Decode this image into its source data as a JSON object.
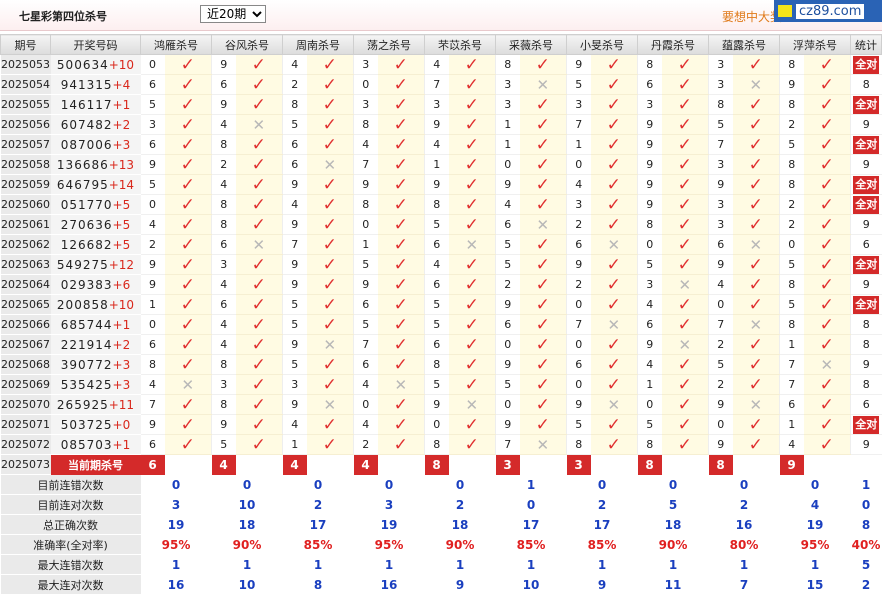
{
  "header": {
    "title": "七星彩第四位杀号",
    "period_selected": "近20期",
    "period_options": [
      "近20期"
    ],
    "promo": "要想中大奖",
    "watermark": "cz89.com"
  },
  "columns": {
    "issue": "期号",
    "number": "开奖号码",
    "experts": [
      "鸿雁杀号",
      "谷风杀号",
      "周南杀号",
      "荡之杀号",
      "芣苡杀号",
      "采薇杀号",
      "小旻杀号",
      "丹霞杀号",
      "蕴露杀号",
      "浮萍杀号"
    ],
    "stat": "统计"
  },
  "all_right_label": "全对",
  "rows": [
    {
      "issue": "2025053",
      "digits": "500634",
      "sum": "+10",
      "kills": [
        [
          "0",
          1
        ],
        [
          "9",
          1
        ],
        [
          "4",
          1
        ],
        [
          "3",
          1
        ],
        [
          "4",
          1
        ],
        [
          "8",
          1
        ],
        [
          "9",
          1
        ],
        [
          "8",
          1
        ],
        [
          "3",
          1
        ],
        [
          "8",
          1
        ]
      ],
      "stat": "全对"
    },
    {
      "issue": "2025054",
      "digits": "941315",
      "sum": "+4",
      "kills": [
        [
          "6",
          1
        ],
        [
          "6",
          1
        ],
        [
          "2",
          1
        ],
        [
          "0",
          1
        ],
        [
          "7",
          1
        ],
        [
          "3",
          0
        ],
        [
          "5",
          1
        ],
        [
          "6",
          1
        ],
        [
          "3",
          0
        ],
        [
          "9",
          1
        ]
      ],
      "stat": "8"
    },
    {
      "issue": "2025055",
      "digits": "146117",
      "sum": "+1",
      "kills": [
        [
          "5",
          1
        ],
        [
          "9",
          1
        ],
        [
          "8",
          1
        ],
        [
          "3",
          1
        ],
        [
          "3",
          1
        ],
        [
          "3",
          1
        ],
        [
          "3",
          1
        ],
        [
          "3",
          1
        ],
        [
          "8",
          1
        ],
        [
          "8",
          1
        ]
      ],
      "stat": "全对"
    },
    {
      "issue": "2025056",
      "digits": "607482",
      "sum": "+2",
      "kills": [
        [
          "3",
          1
        ],
        [
          "4",
          0
        ],
        [
          "5",
          1
        ],
        [
          "8",
          1
        ],
        [
          "9",
          1
        ],
        [
          "1",
          1
        ],
        [
          "7",
          1
        ],
        [
          "9",
          1
        ],
        [
          "5",
          1
        ],
        [
          "2",
          1
        ]
      ],
      "stat": "9"
    },
    {
      "issue": "2025057",
      "digits": "087006",
      "sum": "+3",
      "kills": [
        [
          "6",
          1
        ],
        [
          "8",
          1
        ],
        [
          "6",
          1
        ],
        [
          "4",
          1
        ],
        [
          "4",
          1
        ],
        [
          "1",
          1
        ],
        [
          "1",
          1
        ],
        [
          "9",
          1
        ],
        [
          "7",
          1
        ],
        [
          "5",
          1
        ]
      ],
      "stat": "全对"
    },
    {
      "issue": "2025058",
      "digits": "136686",
      "sum": "+13",
      "kills": [
        [
          "9",
          1
        ],
        [
          "2",
          1
        ],
        [
          "6",
          0
        ],
        [
          "7",
          1
        ],
        [
          "1",
          1
        ],
        [
          "0",
          1
        ],
        [
          "0",
          1
        ],
        [
          "9",
          1
        ],
        [
          "3",
          1
        ],
        [
          "8",
          1
        ]
      ],
      "stat": "9"
    },
    {
      "issue": "2025059",
      "digits": "646795",
      "sum": "+14",
      "kills": [
        [
          "5",
          1
        ],
        [
          "4",
          1
        ],
        [
          "9",
          1
        ],
        [
          "9",
          1
        ],
        [
          "9",
          1
        ],
        [
          "9",
          1
        ],
        [
          "4",
          1
        ],
        [
          "9",
          1
        ],
        [
          "9",
          1
        ],
        [
          "8",
          1
        ]
      ],
      "stat": "全对"
    },
    {
      "issue": "2025060",
      "digits": "051770",
      "sum": "+5",
      "kills": [
        [
          "0",
          1
        ],
        [
          "8",
          1
        ],
        [
          "4",
          1
        ],
        [
          "8",
          1
        ],
        [
          "8",
          1
        ],
        [
          "4",
          1
        ],
        [
          "3",
          1
        ],
        [
          "9",
          1
        ],
        [
          "3",
          1
        ],
        [
          "2",
          1
        ]
      ],
      "stat": "全对"
    },
    {
      "issue": "2025061",
      "digits": "270636",
      "sum": "+5",
      "kills": [
        [
          "4",
          1
        ],
        [
          "8",
          1
        ],
        [
          "9",
          1
        ],
        [
          "0",
          1
        ],
        [
          "5",
          1
        ],
        [
          "6",
          0
        ],
        [
          "2",
          1
        ],
        [
          "8",
          1
        ],
        [
          "3",
          1
        ],
        [
          "2",
          1
        ]
      ],
      "stat": "9"
    },
    {
      "issue": "2025062",
      "digits": "126682",
      "sum": "+5",
      "kills": [
        [
          "2",
          1
        ],
        [
          "6",
          0
        ],
        [
          "7",
          1
        ],
        [
          "1",
          1
        ],
        [
          "6",
          0
        ],
        [
          "5",
          1
        ],
        [
          "6",
          0
        ],
        [
          "0",
          1
        ],
        [
          "6",
          0
        ],
        [
          "0",
          1
        ]
      ],
      "stat": "6"
    },
    {
      "issue": "2025063",
      "digits": "549275",
      "sum": "+12",
      "kills": [
        [
          "9",
          1
        ],
        [
          "3",
          1
        ],
        [
          "9",
          1
        ],
        [
          "5",
          1
        ],
        [
          "4",
          1
        ],
        [
          "5",
          1
        ],
        [
          "9",
          1
        ],
        [
          "5",
          1
        ],
        [
          "9",
          1
        ],
        [
          "5",
          1
        ]
      ],
      "stat": "全对"
    },
    {
      "issue": "2025064",
      "digits": "029383",
      "sum": "+6",
      "kills": [
        [
          "9",
          1
        ],
        [
          "4",
          1
        ],
        [
          "9",
          1
        ],
        [
          "9",
          1
        ],
        [
          "6",
          1
        ],
        [
          "2",
          1
        ],
        [
          "2",
          1
        ],
        [
          "3",
          0
        ],
        [
          "4",
          1
        ],
        [
          "8",
          1
        ]
      ],
      "stat": "9"
    },
    {
      "issue": "2025065",
      "digits": "200858",
      "sum": "+10",
      "kills": [
        [
          "1",
          1
        ],
        [
          "6",
          1
        ],
        [
          "5",
          1
        ],
        [
          "6",
          1
        ],
        [
          "5",
          1
        ],
        [
          "9",
          1
        ],
        [
          "0",
          1
        ],
        [
          "4",
          1
        ],
        [
          "0",
          1
        ],
        [
          "5",
          1
        ]
      ],
      "stat": "全对"
    },
    {
      "issue": "2025066",
      "digits": "685744",
      "sum": "+1",
      "kills": [
        [
          "0",
          1
        ],
        [
          "4",
          1
        ],
        [
          "5",
          1
        ],
        [
          "5",
          1
        ],
        [
          "5",
          1
        ],
        [
          "6",
          1
        ],
        [
          "7",
          0
        ],
        [
          "6",
          1
        ],
        [
          "7",
          0
        ],
        [
          "8",
          1
        ]
      ],
      "stat": "8"
    },
    {
      "issue": "2025067",
      "digits": "221914",
      "sum": "+2",
      "kills": [
        [
          "6",
          1
        ],
        [
          "4",
          1
        ],
        [
          "9",
          0
        ],
        [
          "7",
          1
        ],
        [
          "6",
          1
        ],
        [
          "0",
          1
        ],
        [
          "0",
          1
        ],
        [
          "9",
          0
        ],
        [
          "2",
          1
        ],
        [
          "1",
          1
        ]
      ],
      "stat": "8"
    },
    {
      "issue": "2025068",
      "digits": "390772",
      "sum": "+3",
      "kills": [
        [
          "8",
          1
        ],
        [
          "8",
          1
        ],
        [
          "5",
          1
        ],
        [
          "6",
          1
        ],
        [
          "8",
          1
        ],
        [
          "9",
          1
        ],
        [
          "6",
          1
        ],
        [
          "4",
          1
        ],
        [
          "5",
          1
        ],
        [
          "7",
          0
        ]
      ],
      "stat": "9"
    },
    {
      "issue": "2025069",
      "digits": "535425",
      "sum": "+3",
      "kills": [
        [
          "4",
          0
        ],
        [
          "3",
          1
        ],
        [
          "3",
          1
        ],
        [
          "4",
          0
        ],
        [
          "5",
          1
        ],
        [
          "5",
          1
        ],
        [
          "0",
          1
        ],
        [
          "1",
          1
        ],
        [
          "2",
          1
        ],
        [
          "7",
          1
        ]
      ],
      "stat": "8"
    },
    {
      "issue": "2025070",
      "digits": "265925",
      "sum": "+11",
      "kills": [
        [
          "7",
          1
        ],
        [
          "8",
          1
        ],
        [
          "9",
          0
        ],
        [
          "0",
          1
        ],
        [
          "9",
          0
        ],
        [
          "0",
          1
        ],
        [
          "9",
          0
        ],
        [
          "0",
          1
        ],
        [
          "9",
          0
        ],
        [
          "6",
          1
        ]
      ],
      "stat": "6"
    },
    {
      "issue": "2025071",
      "digits": "503725",
      "sum": "+0",
      "kills": [
        [
          "9",
          1
        ],
        [
          "9",
          1
        ],
        [
          "4",
          1
        ],
        [
          "4",
          1
        ],
        [
          "0",
          1
        ],
        [
          "9",
          1
        ],
        [
          "5",
          1
        ],
        [
          "5",
          1
        ],
        [
          "0",
          1
        ],
        [
          "1",
          1
        ]
      ],
      "stat": "全对"
    },
    {
      "issue": "2025072",
      "digits": "085703",
      "sum": "+1",
      "kills": [
        [
          "6",
          1
        ],
        [
          "5",
          1
        ],
        [
          "1",
          1
        ],
        [
          "2",
          1
        ],
        [
          "8",
          1
        ],
        [
          "7",
          0
        ],
        [
          "8",
          1
        ],
        [
          "8",
          1
        ],
        [
          "9",
          1
        ],
        [
          "4",
          1
        ]
      ],
      "stat": "9"
    }
  ],
  "current": {
    "issue": "2025073",
    "label": "当前期杀号",
    "kills": [
      "6",
      "4",
      "4",
      "4",
      "8",
      "3",
      "3",
      "8",
      "8",
      "9"
    ]
  },
  "summary": [
    {
      "label": "目前连错次数",
      "values": [
        "0",
        "0",
        "0",
        "0",
        "0",
        "1",
        "0",
        "0",
        "0",
        "0"
      ],
      "stat": "1"
    },
    {
      "label": "目前连对次数",
      "values": [
        "3",
        "10",
        "2",
        "3",
        "2",
        "0",
        "2",
        "5",
        "2",
        "4"
      ],
      "stat": "0"
    },
    {
      "label": "总正确次数",
      "values": [
        "19",
        "18",
        "17",
        "19",
        "18",
        "17",
        "17",
        "18",
        "16",
        "19"
      ],
      "stat": "8"
    },
    {
      "label": "准确率(全对率)",
      "values": [
        "95%",
        "90%",
        "85%",
        "95%",
        "90%",
        "85%",
        "85%",
        "90%",
        "80%",
        "95%"
      ],
      "stat": "40%"
    },
    {
      "label": "最大连错次数",
      "values": [
        "1",
        "1",
        "1",
        "1",
        "1",
        "1",
        "1",
        "1",
        "1",
        "1"
      ],
      "stat": "5"
    },
    {
      "label": "最大连对次数",
      "values": [
        "16",
        "10",
        "8",
        "16",
        "9",
        "10",
        "9",
        "11",
        "7",
        "15"
      ],
      "stat": "2"
    }
  ],
  "marks": {
    "ok": "✓",
    "no": "✕"
  },
  "colors": {
    "accent": "#d42a2a",
    "summary_blue": "#1a3fbf",
    "percent_red": "#e02020",
    "kill_bg": "#fffbe3"
  }
}
